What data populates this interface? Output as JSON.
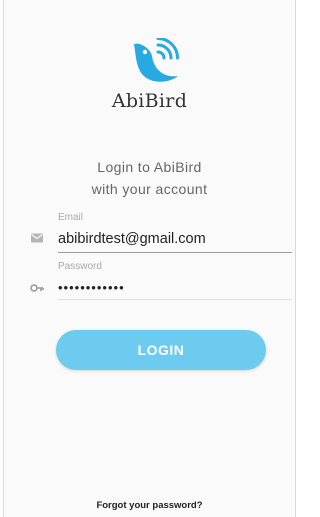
{
  "app": {
    "name": "AbiBird"
  },
  "login": {
    "heading_line1": "Login to AbiBird",
    "heading_line2": "with your account",
    "email_label": "Email",
    "email_value": "abibirdtest@gmail.com",
    "password_label": "Password",
    "password_value": "••••••••••••",
    "button_label": "LOGIN",
    "forgot_link": "Forgot your password?"
  },
  "colors": {
    "accent": "#6ecbf0",
    "brand_blue": "#29a9e1",
    "background": "#fafafa"
  },
  "icons": {
    "email": "mail-icon",
    "password": "key-icon"
  }
}
